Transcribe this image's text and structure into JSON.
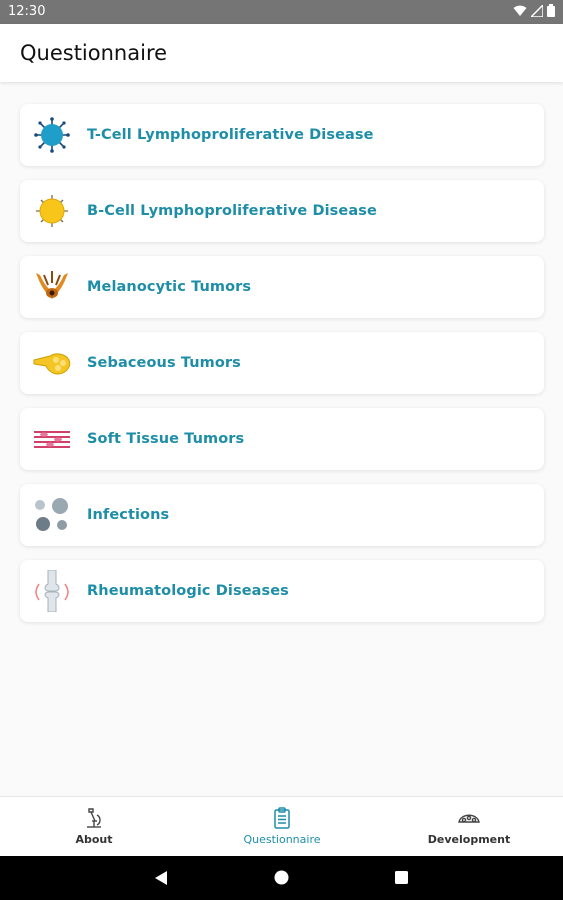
{
  "status": {
    "time": "12:30"
  },
  "app_bar": {
    "title": "Questionnaire"
  },
  "items": [
    {
      "label": "T-Cell Lymphoproliferative Disease",
      "icon": "t-cell-icon"
    },
    {
      "label": "B-Cell Lymphoproliferative Disease",
      "icon": "b-cell-icon"
    },
    {
      "label": "Melanocytic Tumors",
      "icon": "melanocyte-icon"
    },
    {
      "label": "Sebaceous Tumors",
      "icon": "sebaceous-icon"
    },
    {
      "label": "Soft Tissue Tumors",
      "icon": "soft-tissue-icon"
    },
    {
      "label": "Infections",
      "icon": "infection-icon"
    },
    {
      "label": "Rheumatologic Diseases",
      "icon": "joint-icon"
    }
  ],
  "bottom_nav": {
    "about": "About",
    "questionnaire": "Questionnaire",
    "development": "Development",
    "active": "questionnaire"
  },
  "colors": {
    "accent": "#1e8ea8",
    "status_bar": "#757575"
  }
}
